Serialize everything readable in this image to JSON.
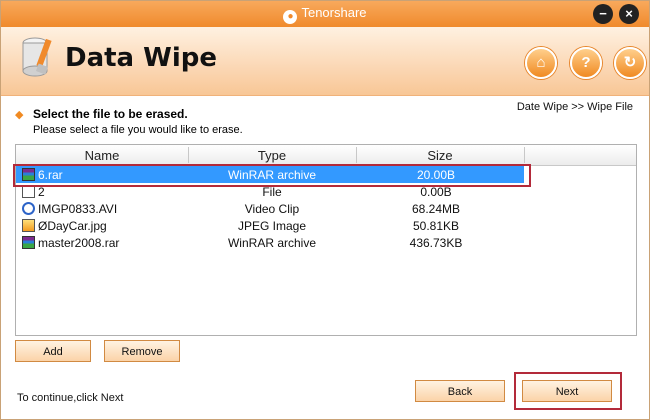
{
  "titlebar": {
    "brand": "Tenorshare",
    "minimize_label": "−",
    "close_label": "×"
  },
  "header": {
    "app_title": "Data Wipe",
    "home_label": "⌂",
    "help_label": "?",
    "update_label": "↻"
  },
  "step": {
    "marker": "◆",
    "title": "Select the file to be erased.",
    "description": "Please select a file you would like to erase.",
    "breadcrumb": "Date Wipe >> Wipe File"
  },
  "file_list": {
    "columns": [
      "Name",
      "Type",
      "Size"
    ],
    "rows": [
      {
        "name": "6.rar",
        "type": "WinRAR archive",
        "size": "20.00B",
        "icon": "rar-icon",
        "selected": true
      },
      {
        "name": "2",
        "type": "File",
        "size": "0.00B",
        "icon": "file-icon",
        "selected": false
      },
      {
        "name": "IMGP0833.AVI",
        "type": "Video Clip",
        "size": "68.24MB",
        "icon": "video-file-icon",
        "selected": false
      },
      {
        "name": "ØDayCar.jpg",
        "type": "JPEG Image",
        "size": "50.81KB",
        "icon": "image-file-icon",
        "selected": false
      },
      {
        "name": "master2008.rar",
        "type": "WinRAR archive",
        "size": "436.73KB",
        "icon": "rar-icon",
        "selected": false
      }
    ]
  },
  "buttons": {
    "add": "Add",
    "remove": "Remove",
    "back": "Back",
    "next": "Next"
  },
  "status": {
    "text": "To continue,click Next"
  },
  "colors": {
    "accent": "#f08a2c",
    "selection": "#3399ff",
    "highlight_border": "#b32a3a"
  }
}
